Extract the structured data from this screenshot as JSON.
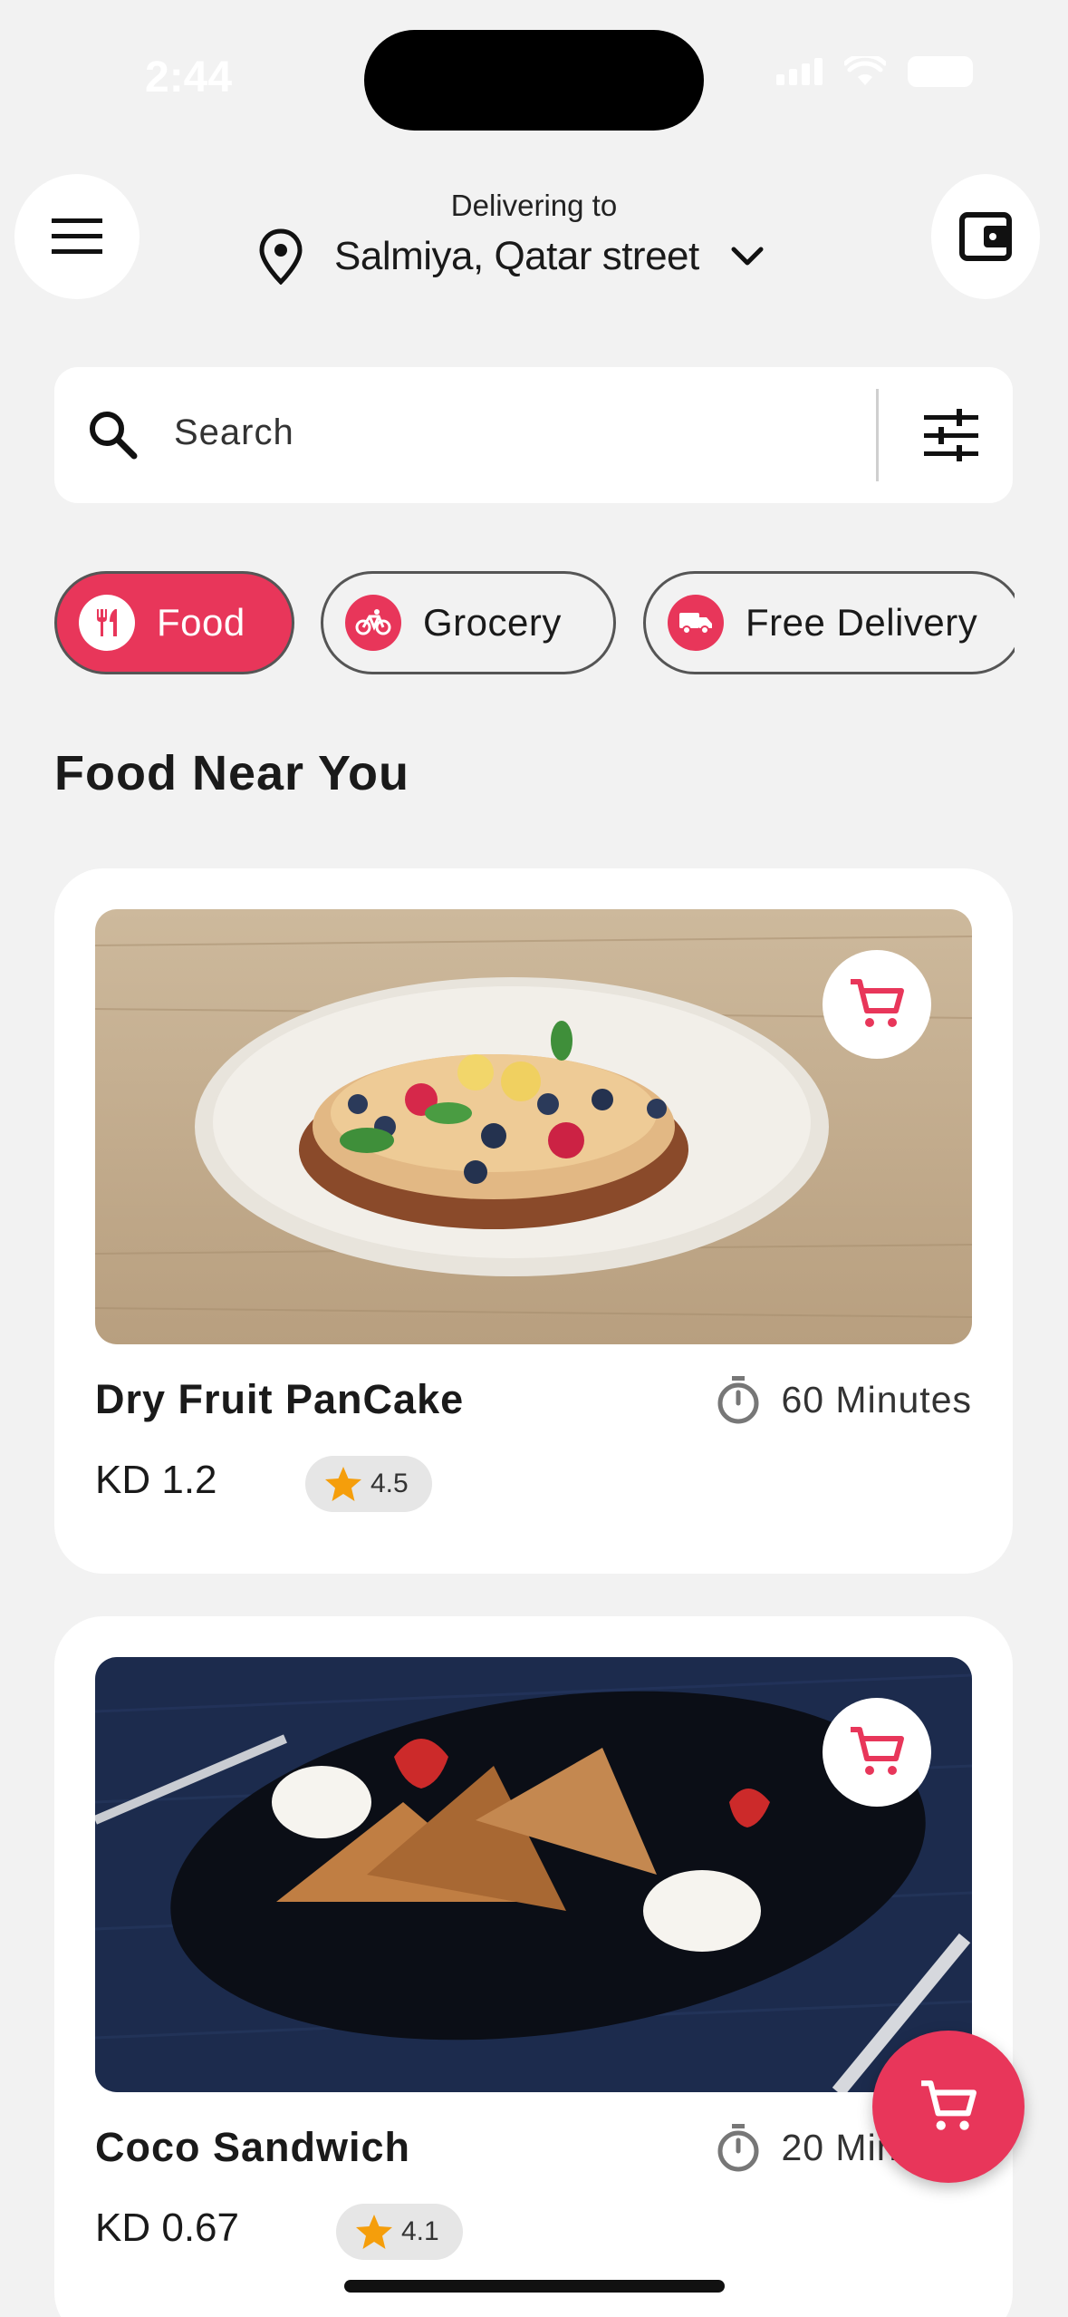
{
  "status_bar": {
    "time": "2:44"
  },
  "header": {
    "delivering_label": "Delivering to",
    "location": "Salmiya, Qatar street"
  },
  "search": {
    "placeholder": "Search"
  },
  "categories": [
    {
      "label": "Food",
      "icon": "utensils-icon",
      "selected": true
    },
    {
      "label": "Grocery",
      "icon": "bicycle-icon",
      "selected": false
    },
    {
      "label": "Free Delivery",
      "icon": "truck-icon",
      "selected": false
    }
  ],
  "section": {
    "title": "Food Near You"
  },
  "foods": [
    {
      "name": "Dry Fruit PanCake",
      "time": "60 Minutes",
      "price": "KD 1.2",
      "rating": "4.5"
    },
    {
      "name": "Coco Sandwich",
      "time": "20 Minutes",
      "price": "KD 0.67",
      "rating": "4.1"
    }
  ],
  "colors": {
    "accent": "#e8365a",
    "background": "#f2f2f2",
    "star": "#f59e0b"
  }
}
